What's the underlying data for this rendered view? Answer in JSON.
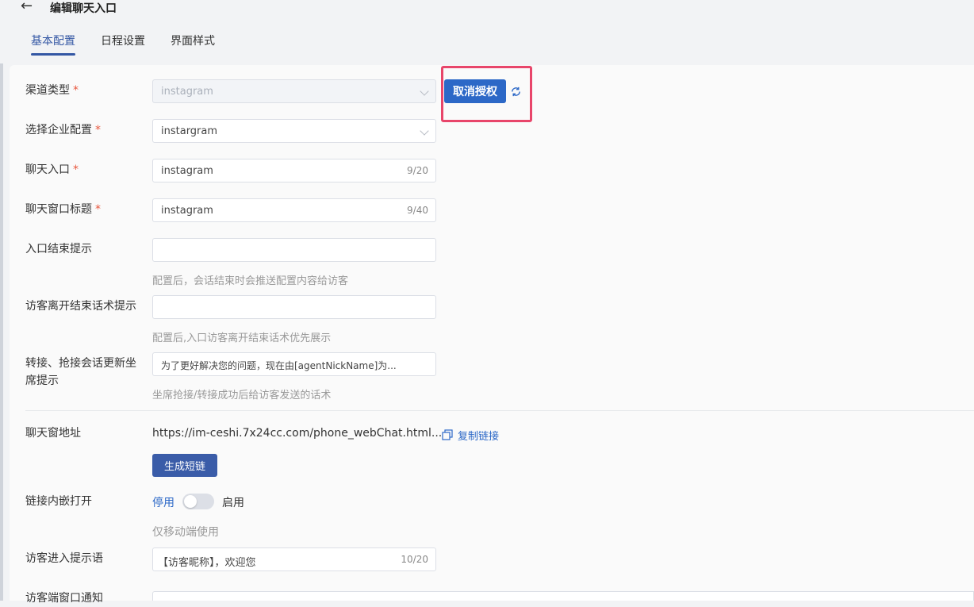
{
  "header": {
    "title": "编辑聊天入口",
    "tabs": [
      {
        "label": "基本配置"
      },
      {
        "label": "日程设置"
      },
      {
        "label": "界面样式"
      }
    ]
  },
  "form": {
    "channel_type": {
      "label": "渠道类型",
      "required": "*",
      "value": "instagram"
    },
    "revoke_button": "取消授权",
    "enterprise": {
      "label": "选择企业配置",
      "required": "*",
      "value": "instargram"
    },
    "entry": {
      "label": "聊天入口",
      "required": "*",
      "value": "instagram",
      "count": "9/20"
    },
    "window_title": {
      "label": "聊天窗口标题",
      "required": "*",
      "value": "instagram",
      "count": "9/40"
    },
    "end_hint": {
      "label": "入口结束提示",
      "value": "",
      "hint": "配置后，会话结束时会推送配置内容给访客"
    },
    "leave_hint": {
      "label": "访客离开结束话术提示",
      "value": "",
      "hint": "配置后,入口访客离开结束话术优先展示"
    },
    "transfer_hint": {
      "label_line1": "转接、抢接会话更新坐",
      "label_line2": "席提示",
      "value": "为了更好解决您的问题，现在由[agentNickName]为...",
      "hint": "坐席抢接/转接成功后给访客发送的话术"
    },
    "chat_url": {
      "label": "聊天窗地址",
      "value": "https://im-ceshi.7x24cc.com/phone_webChat.html...",
      "copy_label": "复制链接"
    },
    "short_link_button": "生成短链",
    "embed_open": {
      "label": "链接内嵌打开",
      "off_label": "停用",
      "on_label": "启用",
      "enabled": false,
      "hint": "仅移动端使用"
    },
    "visitor_greeting": {
      "label": "访客进入提示语",
      "value": "【访客昵称】，欢迎您",
      "count": "10/20"
    },
    "visitor_notice": {
      "label": "访客端窗口通知"
    }
  },
  "colors": {
    "primary": "#2c68c7",
    "highlight": "#e8456a",
    "required": "#e8573e"
  }
}
